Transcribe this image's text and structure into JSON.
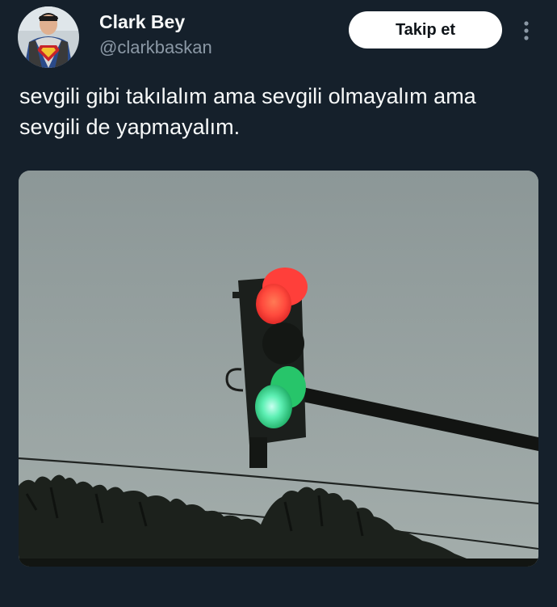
{
  "tweet": {
    "author": {
      "name": "Clark Bey",
      "handle": "@clarkbaskan",
      "avatar_icon": "superman-avatar"
    },
    "follow_label": "Takip et",
    "more_icon": "vertical-ellipsis-icon",
    "text": "sevgili gibi takılalım ama sevgili olmayalım ama sevgili de yapmayalım.",
    "media": {
      "type": "photo",
      "subject": "traffic-light-icon"
    }
  },
  "colors": {
    "background": "#15202b",
    "text_primary": "#f7f9f9",
    "text_secondary": "#8b98a5",
    "button_bg": "#ffffff",
    "button_text": "#0f1419",
    "light_red": "#ff4a3d",
    "light_green": "#2ee68a"
  }
}
